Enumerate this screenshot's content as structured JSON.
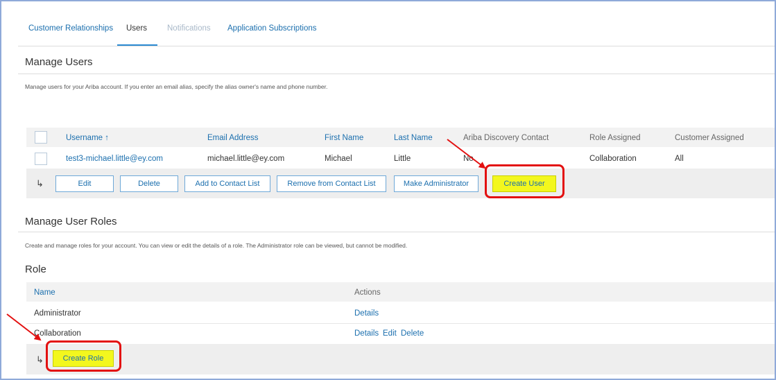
{
  "tabs": [
    {
      "label": "Customer Relationships",
      "state": "normal"
    },
    {
      "label": "Users",
      "state": "active"
    },
    {
      "label": "Notifications",
      "state": "disabled"
    },
    {
      "label": "Application Subscriptions",
      "state": "normal"
    }
  ],
  "manage_users": {
    "title": "Manage Users",
    "description": "Manage users for your Ariba account. If you enter an email alias, specify the alias owner's name and phone number.",
    "columns": [
      "Username ↑",
      "Email Address",
      "First Name",
      "Last Name",
      "Ariba Discovery Contact",
      "Role Assigned",
      "Customer Assigned"
    ],
    "rows": [
      {
        "username": "test3-michael.little@ey.com",
        "email": "michael.little@ey.com",
        "first_name": "Michael",
        "last_name": "Little",
        "discovery_contact": "No",
        "role": "Collaboration",
        "customer": "All"
      }
    ],
    "row_action_glyph": "↳",
    "buttons": {
      "edit": "Edit",
      "delete": "Delete",
      "add_contact": "Add to Contact List",
      "remove_contact": "Remove from Contact List",
      "make_admin": "Make Administrator",
      "create_user": "Create User"
    }
  },
  "manage_roles": {
    "title": "Manage User Roles",
    "description": "Create and manage roles for your account. You can view or edit the details of a role. The Administrator role can be viewed, but cannot be modified.",
    "role_heading": "Role",
    "columns": {
      "name": "Name",
      "actions": "Actions"
    },
    "rows": [
      {
        "name": "Administrator",
        "actions": [
          "Details"
        ]
      },
      {
        "name": "Collaboration",
        "actions": [
          "Details",
          "Edit",
          "Delete"
        ]
      }
    ],
    "row_action_glyph": "↳",
    "create_role": "Create Role"
  },
  "colors": {
    "link": "#1b6fae",
    "tab_underline": "#2b8ad2",
    "highlight": "#f3f71e",
    "callout": "#e31010",
    "frame": "#8fa9d9"
  }
}
